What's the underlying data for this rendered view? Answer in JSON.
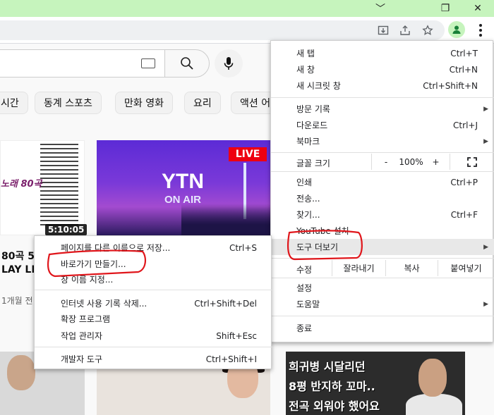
{
  "window": {
    "controls": {
      "minimize": "﹀",
      "restore": "❐",
      "close": "✕"
    }
  },
  "toolbar": {
    "icons": [
      "install-icon",
      "share-icon",
      "bookmark-star-icon",
      "profile-icon",
      "more-menu-icon"
    ]
  },
  "youtube": {
    "chips": [
      "시간",
      "동계 스포츠",
      "만화 영화",
      "요리",
      "액션 어"
    ],
    "video1": {
      "title_fragment": "노래 80곡",
      "duration": "5:10:05"
    },
    "video2": {
      "live_badge": "LIVE",
      "logo": "YTN",
      "sub": "ON AIR"
    },
    "meta": {
      "line1": "80곡 5",
      "line2": "LAY LIST",
      "line3": "1개월 전"
    },
    "thumb5_lines": [
      "희귀병 시달리던",
      "8평 반지하 꼬마..",
      "전곡 외워야 했어요"
    ]
  },
  "menu": {
    "items": [
      {
        "label": "새 탭",
        "shortcut": "Ctrl+T"
      },
      {
        "label": "새 창",
        "shortcut": "Ctrl+N"
      },
      {
        "label": "새 시크릿 창",
        "shortcut": "Ctrl+Shift+N"
      },
      {
        "label": "방문 기록",
        "shortcut": ""
      },
      {
        "label": "다운로드",
        "shortcut": "Ctrl+J"
      },
      {
        "label": "북마크",
        "shortcut": ""
      },
      {
        "label": "인쇄",
        "shortcut": "Ctrl+P"
      },
      {
        "label": "전송...",
        "shortcut": ""
      },
      {
        "label": "찾기...",
        "shortcut": "Ctrl+F"
      },
      {
        "label": "YouTube 설치",
        "shortcut": ""
      },
      {
        "label": "도구 더보기",
        "shortcut": ""
      },
      {
        "label": "설정",
        "shortcut": ""
      },
      {
        "label": "도움말",
        "shortcut": ""
      },
      {
        "label": "종료",
        "shortcut": ""
      }
    ],
    "zoom": {
      "label": "글꼴 크기",
      "minus": "-",
      "value": "100%",
      "plus": "+"
    },
    "edit": {
      "label": "수정",
      "cut": "잘라내기",
      "copy": "복사",
      "paste": "붙여넣기"
    }
  },
  "submenu": {
    "items": [
      {
        "label": "페이지를 다른 이름으로 저장...",
        "shortcut": "Ctrl+S"
      },
      {
        "label": "바로가기 만들기...",
        "shortcut": ""
      },
      {
        "label": "창 이름 지정...",
        "shortcut": ""
      },
      {
        "label": "인터넷 사용 기록 삭제...",
        "shortcut": "Ctrl+Shift+Del"
      },
      {
        "label": "확장 프로그램",
        "shortcut": ""
      },
      {
        "label": "작업 관리자",
        "shortcut": "Shift+Esc"
      },
      {
        "label": "개발자 도구",
        "shortcut": "Ctrl+Shift+I"
      }
    ]
  },
  "colors": {
    "titlebar": "#c6f4bd",
    "annotation": "#e0161b",
    "live": "#ee1111"
  }
}
